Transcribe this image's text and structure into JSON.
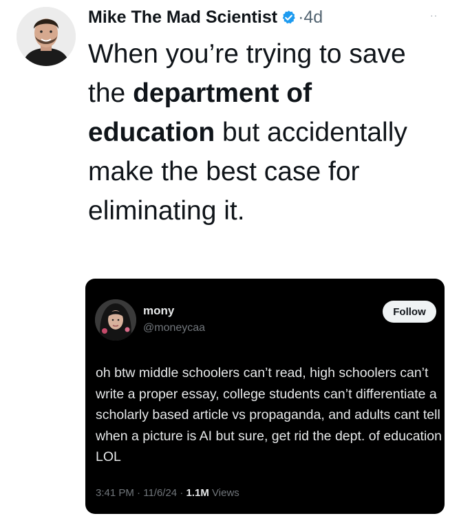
{
  "tweet": {
    "display_name": "Mike The Mad Scientist",
    "separator": "·",
    "time_ago": "4d",
    "more_icon": "more-dots-icon",
    "verified_icon": "verified-badge-icon",
    "verified_color": "#1d9bf0",
    "text_parts": [
      "When you’re trying to save the ",
      "department of education",
      " but accidentally make the best case for eliminating it."
    ]
  },
  "quoted_tweet": {
    "display_name": "mony",
    "handle": "@moneycaa",
    "follow_label": "Follow",
    "body": "oh btw middle schoolers can’t read, high schoolers can’t write a proper essay, college students can’t differentiate a scholarly based article vs propaganda, and adults cant tell when a picture is AI but sure, get rid the dept. of education LOL",
    "time": "3:41 PM",
    "date": "11/6/24",
    "views_count": "1.1M",
    "views_label": "Views",
    "meta_separator": "·"
  }
}
